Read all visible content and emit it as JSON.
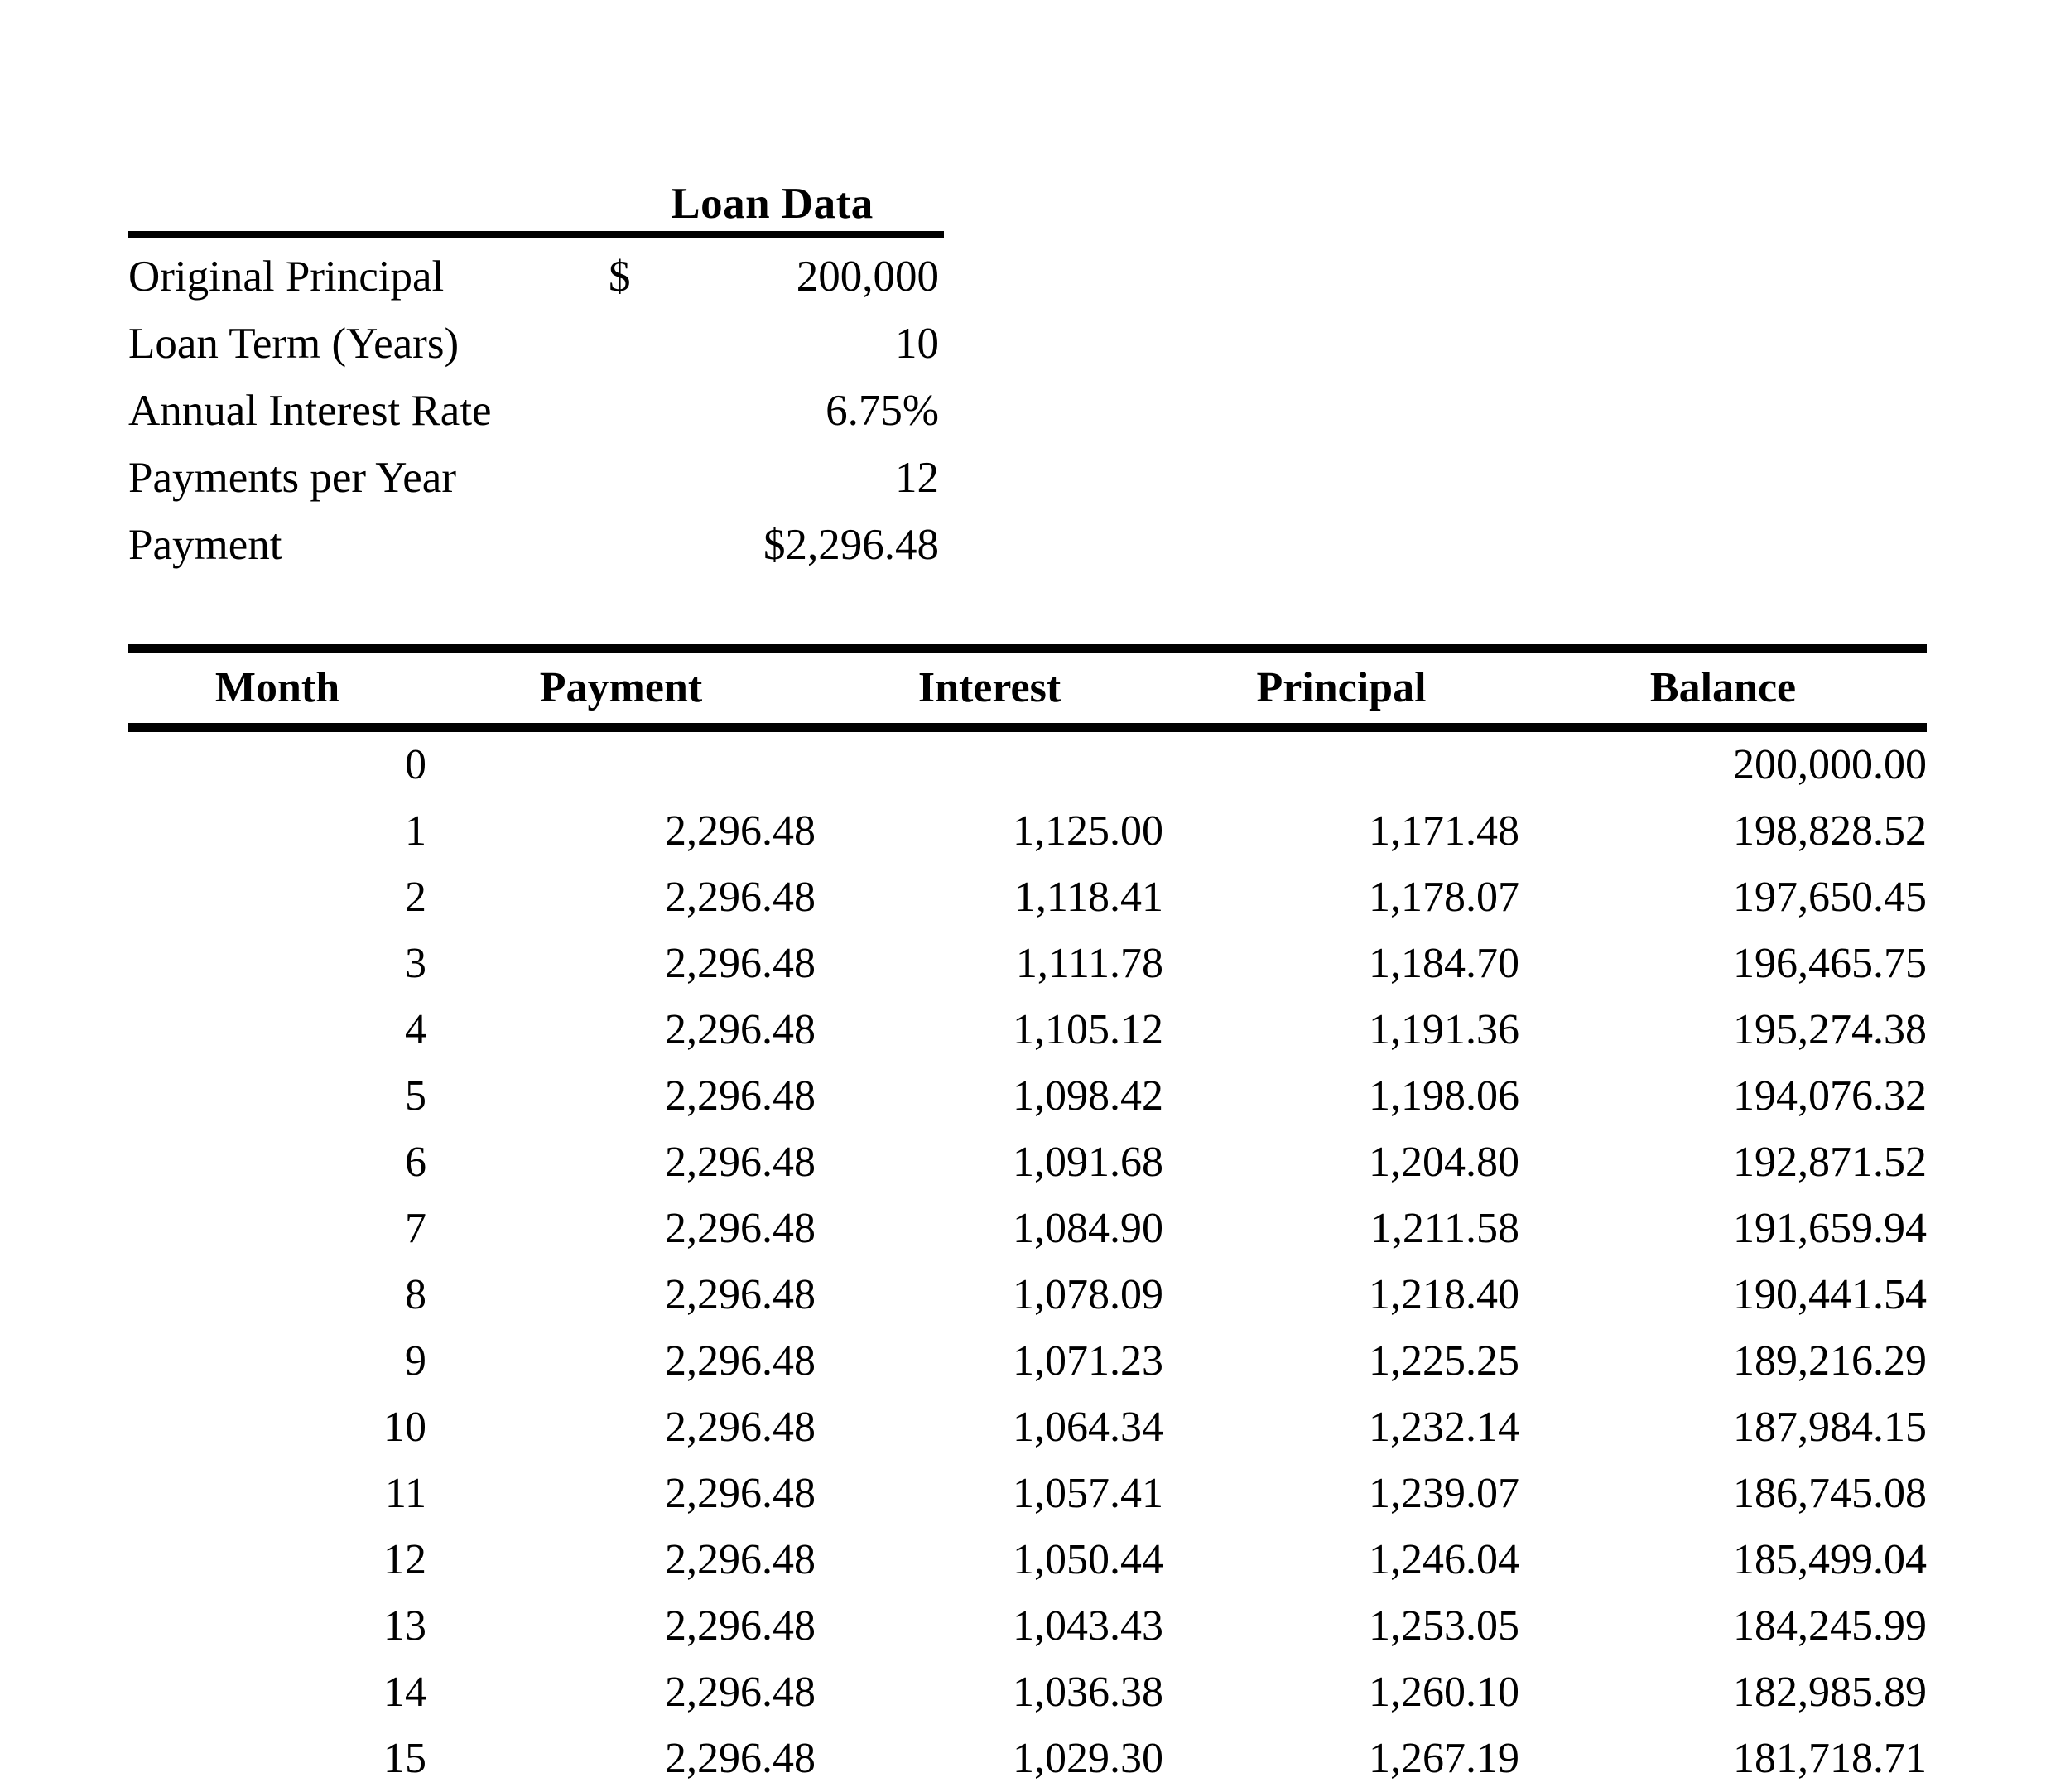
{
  "document": {
    "type": "loan-amortization-schedule"
  },
  "loan_data": {
    "title": "Loan Data",
    "rows": [
      {
        "label": "Original Principal",
        "currency": "$",
        "value": "200,000"
      },
      {
        "label": "Loan Term (Years)",
        "currency": "",
        "value": "10"
      },
      {
        "label": "Annual Interest Rate",
        "currency": "",
        "value": "6.75%"
      },
      {
        "label": "Payments per Year",
        "currency": "",
        "value": "12"
      },
      {
        "label": "Payment",
        "currency": "",
        "value": "$2,296.48"
      }
    ]
  },
  "amortization": {
    "headers": [
      "Month",
      "Payment",
      "Interest",
      "Principal",
      "Balance"
    ],
    "rows": [
      {
        "month": "0",
        "payment": "",
        "interest": "",
        "principal": "",
        "balance": "200,000.00"
      },
      {
        "month": "1",
        "payment": "2,296.48",
        "interest": "1,125.00",
        "principal": "1,171.48",
        "balance": "198,828.52"
      },
      {
        "month": "2",
        "payment": "2,296.48",
        "interest": "1,118.41",
        "principal": "1,178.07",
        "balance": "197,650.45"
      },
      {
        "month": "3",
        "payment": "2,296.48",
        "interest": "1,111.78",
        "principal": "1,184.70",
        "balance": "196,465.75"
      },
      {
        "month": "4",
        "payment": "2,296.48",
        "interest": "1,105.12",
        "principal": "1,191.36",
        "balance": "195,274.38"
      },
      {
        "month": "5",
        "payment": "2,296.48",
        "interest": "1,098.42",
        "principal": "1,198.06",
        "balance": "194,076.32"
      },
      {
        "month": "6",
        "payment": "2,296.48",
        "interest": "1,091.68",
        "principal": "1,204.80",
        "balance": "192,871.52"
      },
      {
        "month": "7",
        "payment": "2,296.48",
        "interest": "1,084.90",
        "principal": "1,211.58",
        "balance": "191,659.94"
      },
      {
        "month": "8",
        "payment": "2,296.48",
        "interest": "1,078.09",
        "principal": "1,218.40",
        "balance": "190,441.54"
      },
      {
        "month": "9",
        "payment": "2,296.48",
        "interest": "1,071.23",
        "principal": "1,225.25",
        "balance": "189,216.29"
      },
      {
        "month": "10",
        "payment": "2,296.48",
        "interest": "1,064.34",
        "principal": "1,232.14",
        "balance": "187,984.15"
      },
      {
        "month": "11",
        "payment": "2,296.48",
        "interest": "1,057.41",
        "principal": "1,239.07",
        "balance": "186,745.08"
      },
      {
        "month": "12",
        "payment": "2,296.48",
        "interest": "1,050.44",
        "principal": "1,246.04",
        "balance": "185,499.04"
      },
      {
        "month": "13",
        "payment": "2,296.48",
        "interest": "1,043.43",
        "principal": "1,253.05",
        "balance": "184,245.99"
      },
      {
        "month": "14",
        "payment": "2,296.48",
        "interest": "1,036.38",
        "principal": "1,260.10",
        "balance": "182,985.89"
      },
      {
        "month": "15",
        "payment": "2,296.48",
        "interest": "1,029.30",
        "principal": "1,267.19",
        "balance": "181,718.71"
      }
    ]
  }
}
